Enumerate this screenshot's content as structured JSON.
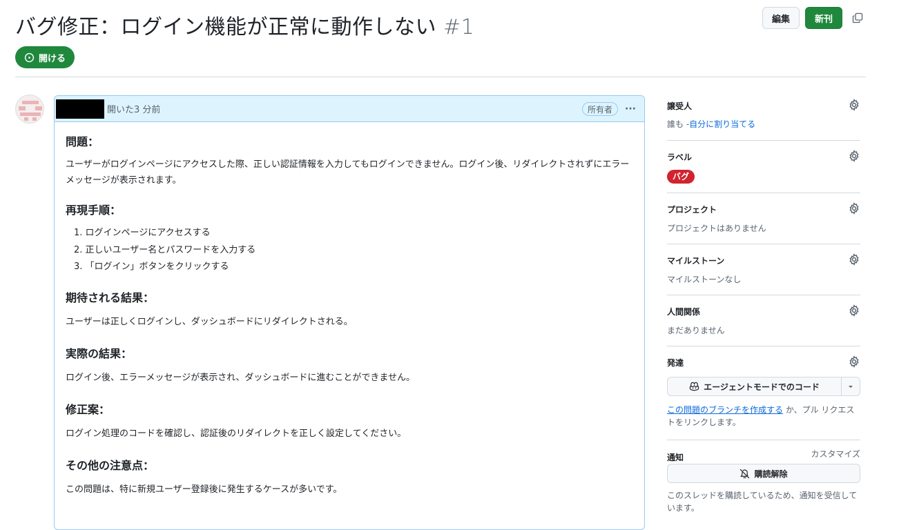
{
  "issue": {
    "title": "バグ修正：ログイン機能が正常に動作しない",
    "number": "#1",
    "state_label": "開ける"
  },
  "header_buttons": {
    "edit_label": "編集",
    "new_label": "新刊"
  },
  "comment": {
    "opened_text": "開いた3 分前",
    "owner_badge": "所有者",
    "sections": [
      {
        "heading": "問題：",
        "text": "ユーザーがログインページにアクセスした際、正しい認証情報を入力してもログインできません。ログイン後、リダイレクトされずにエラーメッセージが表示されます。"
      },
      {
        "heading": "再現手順：",
        "steps": [
          "1. ログインページにアクセスする",
          "2. 正しいユーザー名とパスワードを入力する",
          "3. 「ログイン」ボタンをクリックする"
        ]
      },
      {
        "heading": "期待される結果：",
        "text": "ユーザーは正しくログインし、ダッシュボードにリダイレクトされる。"
      },
      {
        "heading": "実際の結果：",
        "text": "ログイン後、エラーメッセージが表示され、ダッシュボードに進むことができません。"
      },
      {
        "heading": "修正案：",
        "text": "ログイン処理のコードを確認し、認証後のリダイレクトを正しく設定してください。"
      },
      {
        "heading": "その他の注意点：",
        "text": "この問題は、特に新規ユーザー登録後に発生するケースが多いです。"
      }
    ]
  },
  "sidebar": {
    "assignees": {
      "title": "譲受人",
      "prefix": "誰も -",
      "link": "自分に割り当てる"
    },
    "labels": {
      "title": "ラベル",
      "label": "バグ",
      "label_color": "#d1242f"
    },
    "projects": {
      "title": "プロジェクト",
      "empty": "プロジェクトはありません"
    },
    "milestone": {
      "title": "マイルストーン",
      "empty": "マイルストーンなし"
    },
    "relationships": {
      "title": "人間関係",
      "empty": "まだありません"
    },
    "development": {
      "title": "発達",
      "button_label": "エージェントモードでのコード",
      "link": "この問題のブランチを作成する",
      "text_line1": " か、プル リクエス",
      "text_line2": "トをリンクします。"
    },
    "notifications": {
      "title": "通知",
      "customize": "カスタマイズ",
      "button_label": "購読解除",
      "text_line1": "このスレッドを購読しているため、通知を受信して",
      "text_line2": "います。"
    }
  },
  "colors": {
    "primary_green": "#1f883d",
    "link_blue": "#0969da",
    "header_bg": "#ddf4ff",
    "border_blue": "#9ac8f0"
  }
}
